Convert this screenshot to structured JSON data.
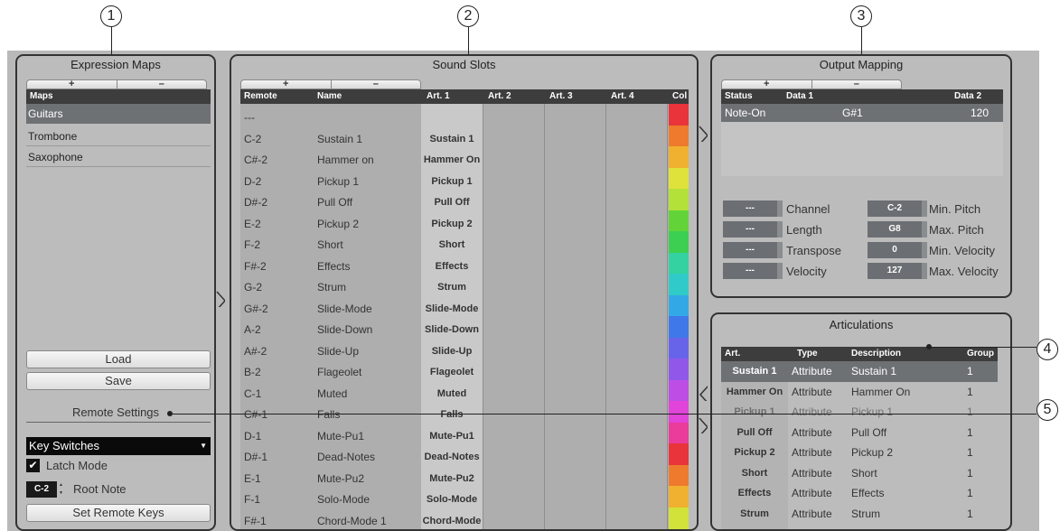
{
  "callouts": [
    "1",
    "2",
    "3",
    "4",
    "5"
  ],
  "pm_plus": "+",
  "pm_minus": "–",
  "expression_maps": {
    "title": "Expression Maps",
    "header": "Maps",
    "items": [
      "Guitars",
      "Trombone",
      "Saxophone"
    ],
    "load": "Load",
    "save": "Save",
    "remote_settings": "Remote Settings",
    "mode": "Key Switches",
    "latch_mode": "Latch Mode",
    "root_note_value": "C-2",
    "root_note_label": "Root Note",
    "set_remote_keys": "Set Remote Keys"
  },
  "sound_slots": {
    "title": "Sound Slots",
    "headers": [
      "Remote",
      "Name",
      "Art. 1",
      "Art. 2",
      "Art. 3",
      "Art. 4",
      "Col"
    ],
    "rows": [
      {
        "remote": "---",
        "name": "",
        "art1": ""
      },
      {
        "remote": "C-2",
        "name": "Sustain 1",
        "art1": "Sustain 1"
      },
      {
        "remote": "C#-2",
        "name": "Hammer on",
        "art1": "Hammer On"
      },
      {
        "remote": "D-2",
        "name": "Pickup 1",
        "art1": "Pickup 1"
      },
      {
        "remote": "D#-2",
        "name": "Pull Off",
        "art1": "Pull Off"
      },
      {
        "remote": "E-2",
        "name": "Pickup 2",
        "art1": "Pickup 2"
      },
      {
        "remote": "F-2",
        "name": "Short",
        "art1": "Short"
      },
      {
        "remote": "F#-2",
        "name": "Effects",
        "art1": "Effects"
      },
      {
        "remote": "G-2",
        "name": "Strum",
        "art1": "Strum"
      },
      {
        "remote": "G#-2",
        "name": "Slide-Mode",
        "art1": "Slide-Mode"
      },
      {
        "remote": "A-2",
        "name": "Slide-Down",
        "art1": "Slide-Down"
      },
      {
        "remote": "A#-2",
        "name": "Slide-Up",
        "art1": "Slide-Up"
      },
      {
        "remote": "B-2",
        "name": "Flageolet",
        "art1": "Flageolet"
      },
      {
        "remote": "C-1",
        "name": "Muted",
        "art1": "Muted"
      },
      {
        "remote": "C#-1",
        "name": "Falls",
        "art1": "Falls"
      },
      {
        "remote": "D-1",
        "name": "Mute-Pu1",
        "art1": "Mute-Pu1"
      },
      {
        "remote": "D#-1",
        "name": "Dead-Notes",
        "art1": "Dead-Notes"
      },
      {
        "remote": "E-1",
        "name": "Mute-Pu2",
        "art1": "Mute-Pu2"
      },
      {
        "remote": "F-1",
        "name": "Solo-Mode",
        "art1": "Solo-Mode"
      },
      {
        "remote": "F#-1",
        "name": "Chord-Mode 1",
        "art1": "Chord-Mode"
      }
    ],
    "colors": [
      "#e8343a",
      "#ee7a2e",
      "#f0b030",
      "#dfe23a",
      "#b4e03a",
      "#62d43a",
      "#3ccf52",
      "#34d2a0",
      "#30cbc8",
      "#33a8e6",
      "#3f78e8",
      "#6864ea",
      "#9058e8",
      "#bc4ee6",
      "#e044d8",
      "#ea3c9a",
      "#e8343a",
      "#ee7a2e",
      "#f0b030",
      "#d2e23a"
    ]
  },
  "output_mapping": {
    "title": "Output Mapping",
    "headers": [
      "Status",
      "Data 1",
      "Data 2"
    ],
    "row": {
      "status": "Note-On",
      "data1": "G#1",
      "data2": "120"
    },
    "left_fields": [
      {
        "value": "---",
        "label": "Channel"
      },
      {
        "value": "---",
        "label": "Length"
      },
      {
        "value": "---",
        "label": "Transpose"
      },
      {
        "value": "---",
        "label": "Velocity"
      }
    ],
    "right_fields": [
      {
        "value": "C-2",
        "label": "Min. Pitch"
      },
      {
        "value": "G8",
        "label": "Max. Pitch"
      },
      {
        "value": "0",
        "label": "Min. Velocity"
      },
      {
        "value": "127",
        "label": "Max. Velocity"
      }
    ]
  },
  "articulations": {
    "title": "Articulations",
    "headers": [
      "Art.",
      "Type",
      "Description",
      "Group"
    ],
    "rows": [
      {
        "art": "Sustain 1",
        "type": "Attribute",
        "desc": "Sustain 1",
        "group": "1"
      },
      {
        "art": "Hammer On",
        "type": "Attribute",
        "desc": "Hammer On",
        "group": "1"
      },
      {
        "art": "Pickup 1",
        "type": "Attribute",
        "desc": "Pickup 1",
        "group": "1"
      },
      {
        "art": "Pull Off",
        "type": "Attribute",
        "desc": "Pull Off",
        "group": "1"
      },
      {
        "art": "Pickup 2",
        "type": "Attribute",
        "desc": "Pickup 2",
        "group": "1"
      },
      {
        "art": "Short",
        "type": "Attribute",
        "desc": "Short",
        "group": "1"
      },
      {
        "art": "Effects",
        "type": "Attribute",
        "desc": "Effects",
        "group": "1"
      },
      {
        "art": "Strum",
        "type": "Attribute",
        "desc": "Strum",
        "group": "1"
      }
    ]
  }
}
